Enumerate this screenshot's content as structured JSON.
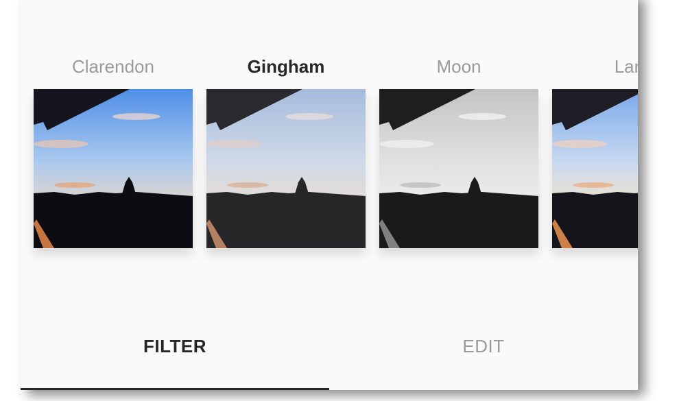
{
  "filters": [
    {
      "name": "Clarendon",
      "selected": false
    },
    {
      "name": "Gingham",
      "selected": true
    },
    {
      "name": "Moon",
      "selected": false
    },
    {
      "name": "Lark",
      "selected": false
    }
  ],
  "tabs": {
    "filter_label": "FILTER",
    "edit_label": "EDIT",
    "active": "filter"
  },
  "colors": {
    "selected_text": "#262626",
    "unselected_text": "#9a9a9a",
    "background": "#fafafa"
  }
}
